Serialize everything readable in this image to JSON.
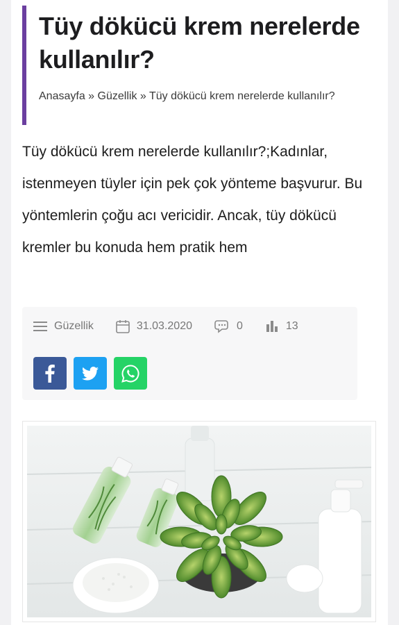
{
  "article": {
    "title": "Tüy dökücü krem nerelerde kullanılır?",
    "breadcrumb": {
      "home": "Anasayfa",
      "separator": "»",
      "category": "Güzellik",
      "current": "Tüy dökücü krem nerelerde kullanılır?"
    },
    "lead": "Tüy dökücü krem nerelerde kullanılır?;Kadınlar, istenmeyen tüyler için pek çok yönteme başvurur. Bu yöntemlerin çoğu acı vericidir. Ancak, tüy dökücü kremler bu konuda hem pratik hem",
    "meta": {
      "category": "Güzellik",
      "date": "31.03.2020",
      "comments": "0",
      "views": "13"
    },
    "share": [
      {
        "network": "facebook",
        "icon": "facebook-icon",
        "color": "#3b5998"
      },
      {
        "network": "twitter",
        "icon": "twitter-icon",
        "color": "#1da1f2"
      },
      {
        "network": "whatsapp",
        "icon": "whatsapp-icon",
        "color": "#25d366"
      }
    ]
  },
  "colors": {
    "accent": "#6b3fa0",
    "meta_text": "#777777"
  }
}
